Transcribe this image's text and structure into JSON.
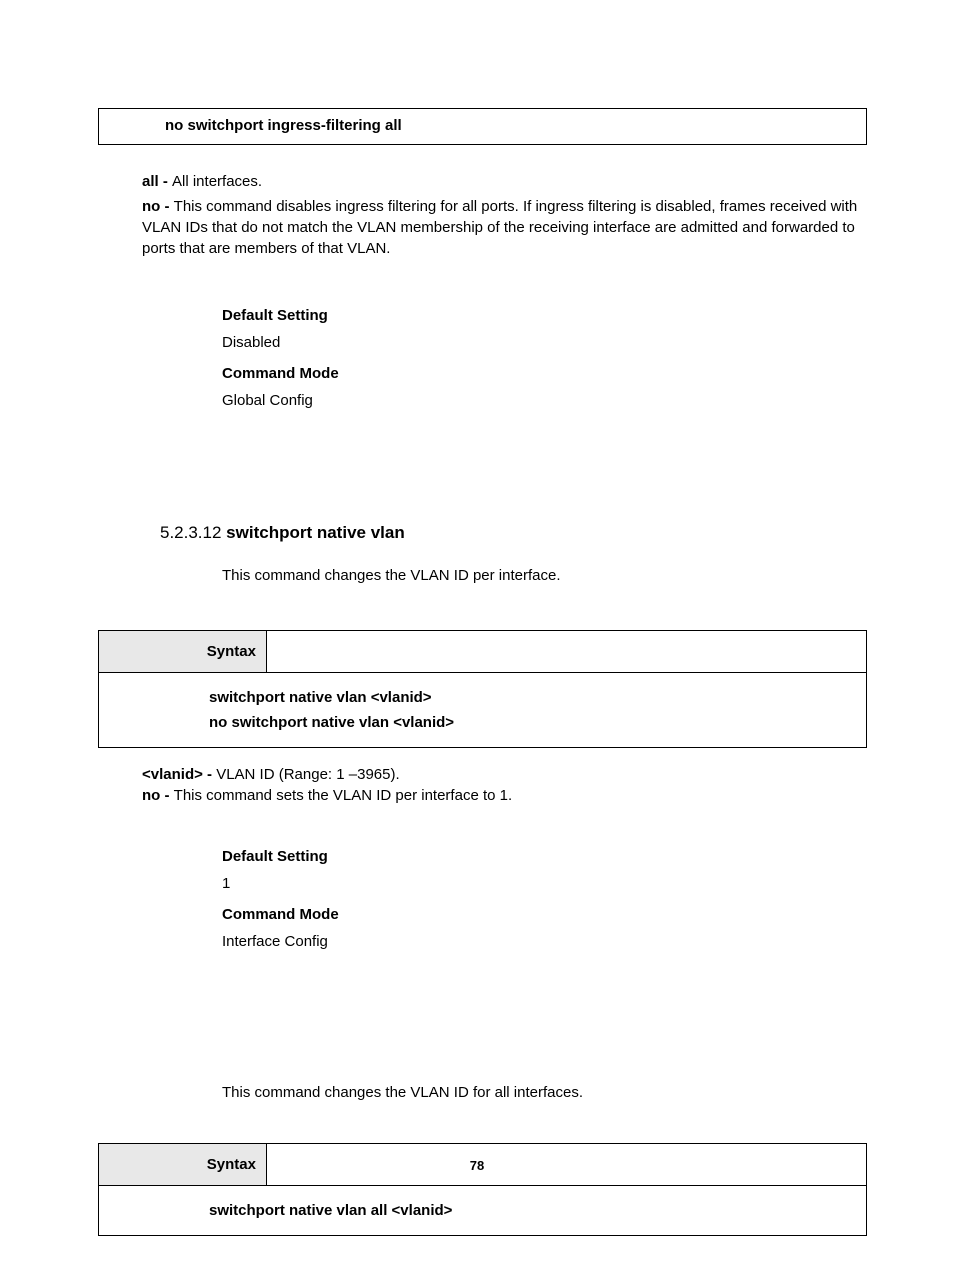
{
  "box1": {
    "cmd": "no switchport ingress-filtering all"
  },
  "params1": {
    "all_label": "all - ",
    "all_desc": "All interfaces.",
    "no_label": "no - ",
    "no_desc": "This command disables ingress filtering for all ports. If ingress filtering is disabled, frames received with VLAN IDs that do not match the VLAN membership of the receiving interface are admitted and forwarded to ports that are members of that VLAN."
  },
  "settings1": {
    "default_label": "Default Setting",
    "default_value": "Disabled",
    "mode_label": "Command Mode",
    "mode_value": "Global Config"
  },
  "section": {
    "num": "5.2.3.12 ",
    "title": "switchport native vlan",
    "desc": "This command changes the VLAN ID per interface."
  },
  "syntax1": {
    "label": "Syntax",
    "line1": "switchport native vlan <vlanid>",
    "line2": "no switchport native vlan <vlanid>"
  },
  "params2": {
    "vlanid_label": "<vlanid> - ",
    "vlanid_desc": "VLAN ID (Range: 1 –3965).",
    "no_label": "no - ",
    "no_desc": "This command sets the VLAN ID per interface to 1."
  },
  "settings2": {
    "default_label": "Default Setting",
    "default_value": "1",
    "mode_label": "Command Mode",
    "mode_value": "Interface Config"
  },
  "secondary": {
    "desc": "This command changes the VLAN ID for all interfaces."
  },
  "syntax2": {
    "label": "Syntax",
    "line1": "switchport native vlan all <vlanid>"
  },
  "page_num": "78"
}
